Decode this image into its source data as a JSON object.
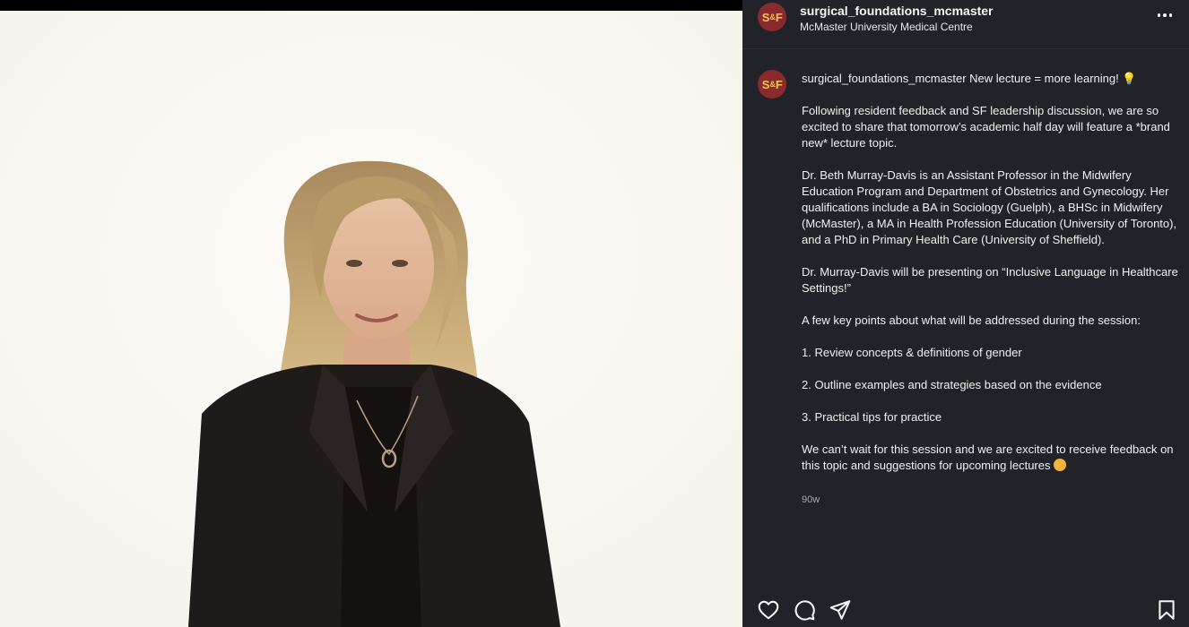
{
  "post": {
    "username": "surgical_foundations_mcmaster",
    "location": "McMaster University Medical Centre",
    "avatar_text": "S&F",
    "avatar_left": "S",
    "avatar_amp": "&",
    "avatar_right": "F",
    "caption": {
      "username": "surgical_foundations_mcmaster",
      "headline": "New lecture = more learning!",
      "p1": "Following resident feedback and SF leadership discussion, we are so excited to share that tomorrow’s academic half day will feature a *brand new* lecture topic.",
      "p2": "Dr. Beth Murray-Davis is an Assistant Professor in the Midwifery Education Program and Department of Obstetrics and Gynecology. Her qualifications include a BA in Sociology (Guelph), a BHSc in Midwifery (McMaster), a MA in Health Profession Education (University of Toronto), and a PhD in Primary Health Care (University of Sheffield).",
      "p3": "Dr. Murray-Davis will be presenting on “Inclusive Language in Healthcare Settings!”",
      "p4": "A few key points about what will be addressed during the session:",
      "point1": "1. Review concepts & definitions of gender",
      "point2": "2. Outline examples and strategies based on the evidence",
      "point3": "3. Practical tips for practice",
      "p5": "We can’t wait for this session and we are excited to receive feedback on this topic and suggestions for upcoming lectures"
    },
    "timestamp": "90w"
  },
  "icons": {
    "more": "more-options-icon",
    "like": "heart-icon",
    "comment": "comment-icon",
    "share": "send-icon",
    "save": "bookmark-icon",
    "headline_emoji": "lightbulb-icon",
    "closing_emoji": "smiling-face-icon"
  },
  "colors": {
    "panel_bg": "#212328",
    "avatar_bg": "#8b2a2e",
    "avatar_text": "#f4c34a",
    "photo_bg": "#fbf9f4"
  }
}
